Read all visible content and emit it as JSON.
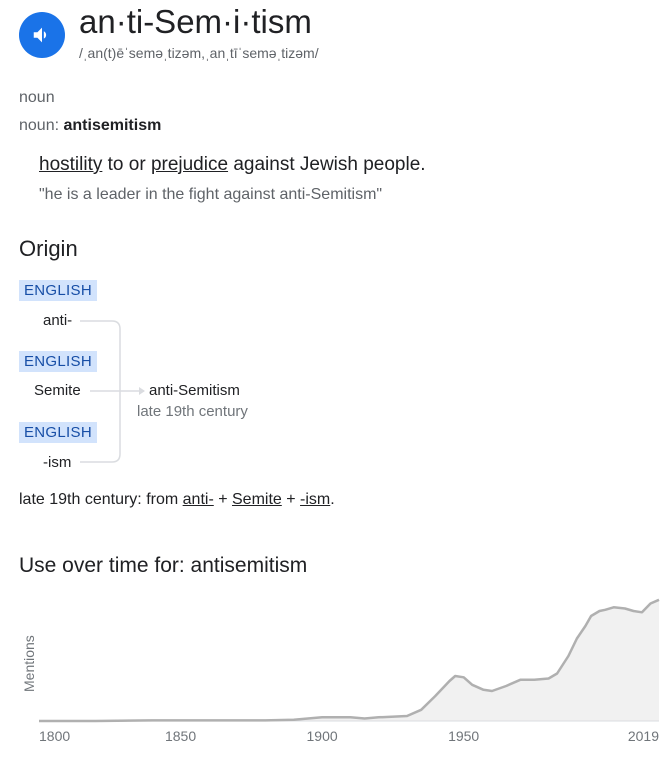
{
  "entry": {
    "headword": "an·ti-Sem·i·tism",
    "phonetic": "/ˌan(t)ēˈseməˌtizəm,ˌanˌtīˈseməˌtizəm/",
    "speaker_icon": "speaker-icon",
    "part_of_speech": "noun",
    "variant_label": "noun:",
    "variant_value": "antisemitism"
  },
  "definition": {
    "link1": "hostility",
    "text1": " to or ",
    "link2": "prejudice",
    "text2": " against Jewish people.",
    "example": "\"he is a leader in the fight against anti-Semitism\""
  },
  "origin": {
    "heading": "Origin",
    "morphemes": [
      {
        "language": "ENGLISH",
        "form": "anti-"
      },
      {
        "language": "ENGLISH",
        "form": "Semite"
      },
      {
        "language": "ENGLISH",
        "form": "-ism"
      }
    ],
    "result_word": "anti-Semitism",
    "result_date": "late 19th century",
    "etymology_prefix": "late 19th century: from ",
    "etymology_links": [
      "anti-",
      "Semite",
      "-ism"
    ],
    "plus": " + ",
    "period": "."
  },
  "usage": {
    "heading": "Use over time for: antisemitism",
    "y_label": "Mentions"
  },
  "chart_data": {
    "type": "area",
    "title": "Use over time for: antisemitism",
    "ylabel": "Mentions",
    "xlabel": "",
    "x_ticks": [
      "1800",
      "1850",
      "1900",
      "1950",
      "2019"
    ],
    "xlim": [
      1800,
      2019
    ],
    "ylim": [
      0,
      100
    ],
    "grid": false,
    "series": [
      {
        "x": [
          1800,
          1820,
          1840,
          1860,
          1880,
          1890,
          1895,
          1900,
          1910,
          1915,
          1920,
          1930,
          1935,
          1940,
          1945,
          1947,
          1950,
          1953,
          1957,
          1960,
          1965,
          1970,
          1975,
          1980,
          1983,
          1987,
          1990,
          1993,
          1995,
          1998,
          2000,
          2003,
          2007,
          2010,
          2013,
          2016,
          2019
        ],
        "values": [
          0,
          0,
          0.5,
          0.5,
          0.5,
          1,
          2,
          3,
          3,
          2,
          3,
          4,
          9,
          20,
          32,
          36,
          35,
          29,
          25,
          24,
          28,
          33,
          33,
          34,
          38,
          52,
          66,
          76,
          84,
          88,
          89,
          91,
          90,
          88,
          87,
          94,
          97
        ]
      }
    ]
  }
}
